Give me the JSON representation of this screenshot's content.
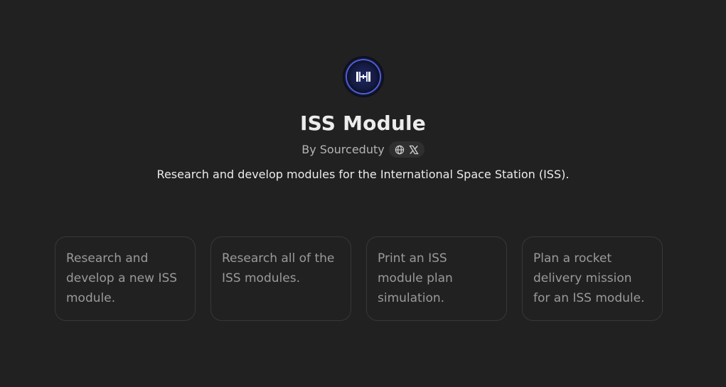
{
  "gpt": {
    "name": "ISS Module",
    "author_prefix": "By",
    "author": "Sourceduty",
    "description": "Research and develop modules for the International Space Station (ISS).",
    "avatar_icon": "space-station-icon",
    "social_icons": [
      "globe-icon",
      "x-logo-icon"
    ]
  },
  "conversation_starters": [
    {
      "text": "Research and develop a new ISS module."
    },
    {
      "text": "Research all of the ISS modules."
    },
    {
      "text": "Print an ISS module plan simulation."
    },
    {
      "text": "Plan a rocket delivery mission for an ISS module."
    }
  ],
  "colors": {
    "background": "#212121",
    "card_border": "#383838",
    "text_primary": "#ececec",
    "text_secondary": "#b4b4b4",
    "accent_ring": "#4c5fd6"
  }
}
